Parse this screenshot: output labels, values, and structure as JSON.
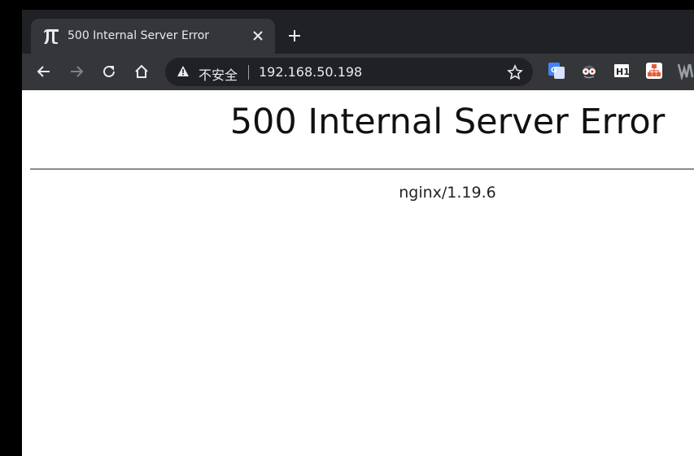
{
  "tab": {
    "title": "500 Internal Server Error",
    "favicon": "pi-icon"
  },
  "toolbar": {
    "security_label": "不安全",
    "url": "192.168.50.198"
  },
  "extensions": [
    "google-translate-icon",
    "spy-glasses-icon",
    "h1-icon",
    "sitemap-icon",
    "partial-extension-icon"
  ],
  "page": {
    "heading": "500 Internal Server Error",
    "server_signature": "nginx/1.19.6"
  },
  "colors": {
    "tabstrip": "#202124",
    "active_tab": "#35363a",
    "omnibox": "#202124",
    "page_background": "#ffffff"
  }
}
